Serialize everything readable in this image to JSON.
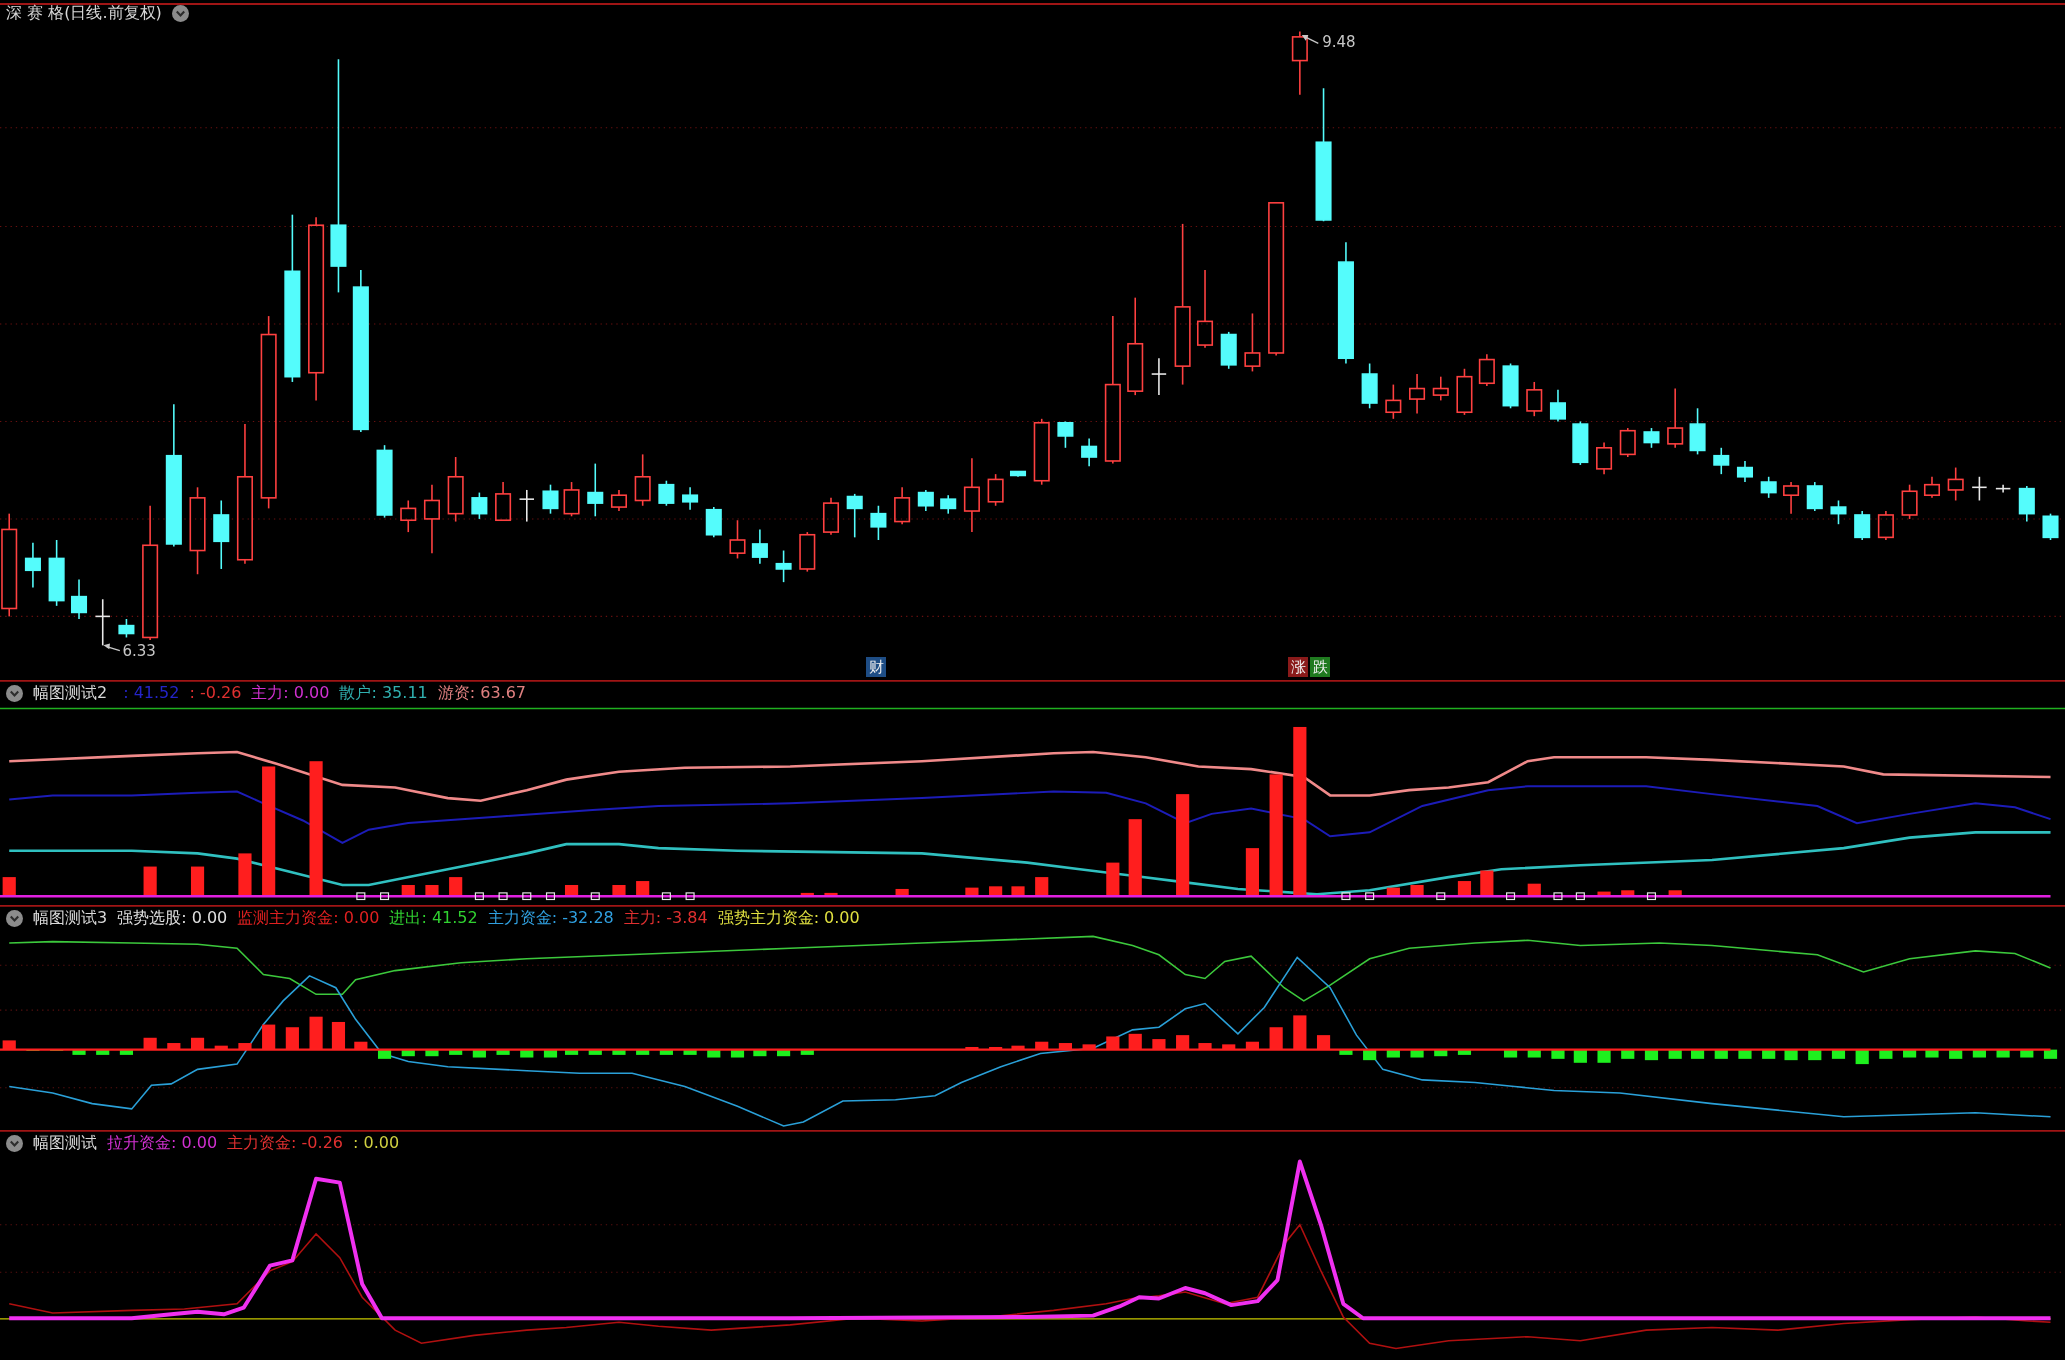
{
  "main_chart": {
    "title": "深 赛 格(日线.前复权)",
    "high_label": "9.48",
    "low_label": "6.33",
    "tags": [
      {
        "text": "财",
        "color": "#1e4d85"
      },
      {
        "text": "涨",
        "color": "#8a1a1a"
      },
      {
        "text": "跌",
        "color": "#1f7a1f"
      }
    ]
  },
  "indicator_panels": [
    {
      "kind": "band",
      "title": "幅图测试2",
      "legend": [
        {
          "text": ": 41.52",
          "color": "#2424c8"
        },
        {
          "text": ": -0.26",
          "color": "#e03030"
        },
        {
          "text": "主力: 0.00",
          "color": "#d030d0"
        },
        {
          "text": "散户: 35.11",
          "color": "#30b0b0"
        },
        {
          "text": "游资: 63.67",
          "color": "#e08080"
        }
      ]
    },
    {
      "kind": "flow",
      "title": "幅图测试3",
      "legend": [
        {
          "text": "强势选股: 0.00",
          "color": "#e0e0e0"
        },
        {
          "text": "监测主力资金: 0.00",
          "color": "#e02020"
        },
        {
          "text": "进出: 41.52",
          "color": "#30d030"
        },
        {
          "text": "主力资金: -32.28",
          "color": "#30a0e0"
        },
        {
          "text": "主力: -3.84",
          "color": "#e03030"
        },
        {
          "text": "强势主力资金: 0.00",
          "color": "#e0e040"
        }
      ]
    },
    {
      "kind": "lift",
      "title": "幅图测试",
      "legend": [
        {
          "text": "拉升资金: 0.00",
          "color": "#d030d0"
        },
        {
          "text": "主力资金: -0.26",
          "color": "#e03030"
        },
        {
          "text": ": 0.00",
          "color": "#d0d040"
        }
      ]
    }
  ]
}
